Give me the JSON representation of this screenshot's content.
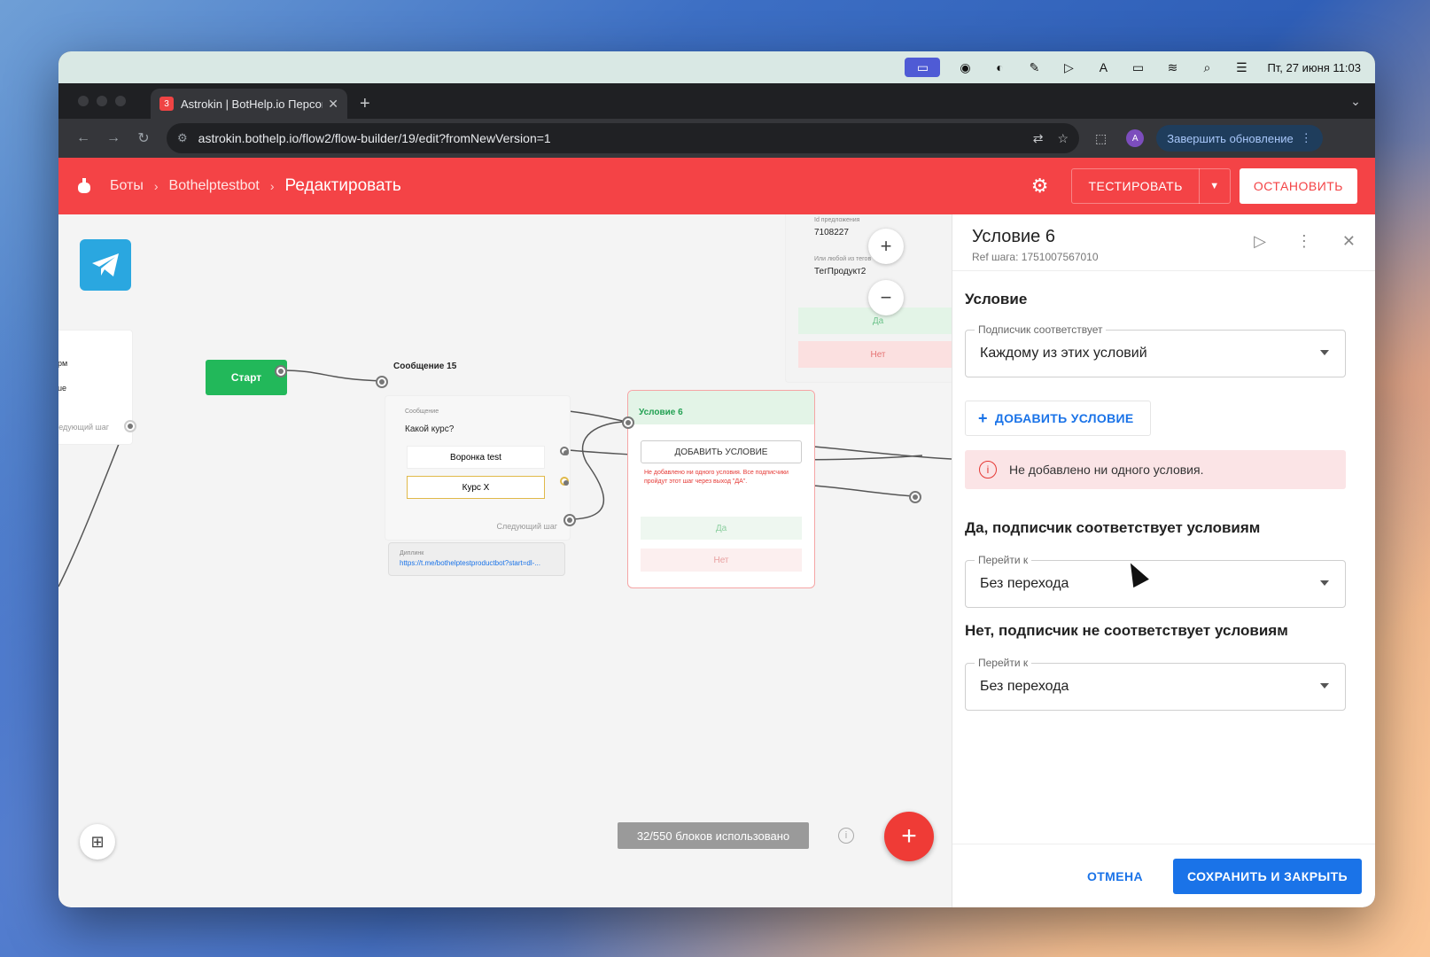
{
  "menubar": {
    "datetime": "Пт, 27 июня  11:03"
  },
  "browser": {
    "tab_title": "Astrokin | BotHelp.io Персон...",
    "tab_badge": "3",
    "url": "astrokin.bothelp.io/flow2/flow-builder/19/edit?fromNewVersion=1",
    "profile_initial": "A",
    "update_label": "Завершить обновление"
  },
  "header": {
    "crumbs": [
      "Боты",
      "Bothelptestbot"
    ],
    "current": "Редактировать",
    "test_label": "ТЕСТИРОВАТЬ",
    "stop_label": "ОСТАНОВИТЬ"
  },
  "canvas": {
    "start_label": "Старт",
    "message_title": "Сообщение 15",
    "message_sub": "Сообщение",
    "message_text": "Какой курс?",
    "buttons": [
      "Воронка test",
      "Курс X"
    ],
    "next_step": "Следующий шаг",
    "deeplink_label": "Диплинк",
    "deeplink_url": "https://t.me/bothelptestproductbot?start=dl-...",
    "left_partial": [
      "рм",
      "ue",
      "ледующий шаг"
    ],
    "cond_title": "Условие 6",
    "cond_add": "ДОБАВИТЬ УСЛОВИЕ",
    "cond_warning": "Не добавлено ни одного условия. Все подписчики пройдут этот шаг через выход \"ДА\".",
    "yes": "Да",
    "no": "Нет",
    "right_offer_label": "Id предложения",
    "right_offer_value": "7108227",
    "right_tag_label": "Или любой из тегов",
    "right_tag_value": "ТегПродукт2",
    "usage": "32/550 блоков использовано",
    "zoom_in": "+",
    "zoom_out": "−",
    "fab": "+",
    "info": "i"
  },
  "panel": {
    "title": "Условие 6",
    "ref": "Ref шага: 1751007567010",
    "section_condition": "Условие",
    "match_label": "Подписчик соответствует",
    "match_value": "Каждому из этих условий",
    "add_condition": "ДОБАВИТЬ УСЛОВИЕ",
    "alert": "Не добавлено ни одного условия.",
    "yes_title": "Да, подписчик соответствует условиям",
    "yes_label": "Перейти к",
    "yes_value": "Без перехода",
    "no_title": "Нет, подписчик не соответствует условиям",
    "no_label": "Перейти к",
    "no_value": "Без перехода",
    "cancel": "ОТМЕНА",
    "save": "СОХРАНИТЬ И ЗАКРЫТЬ"
  },
  "colors": {
    "brand_red": "#f44346",
    "primary_blue": "#1a73e8",
    "start_green": "#22b85a"
  }
}
